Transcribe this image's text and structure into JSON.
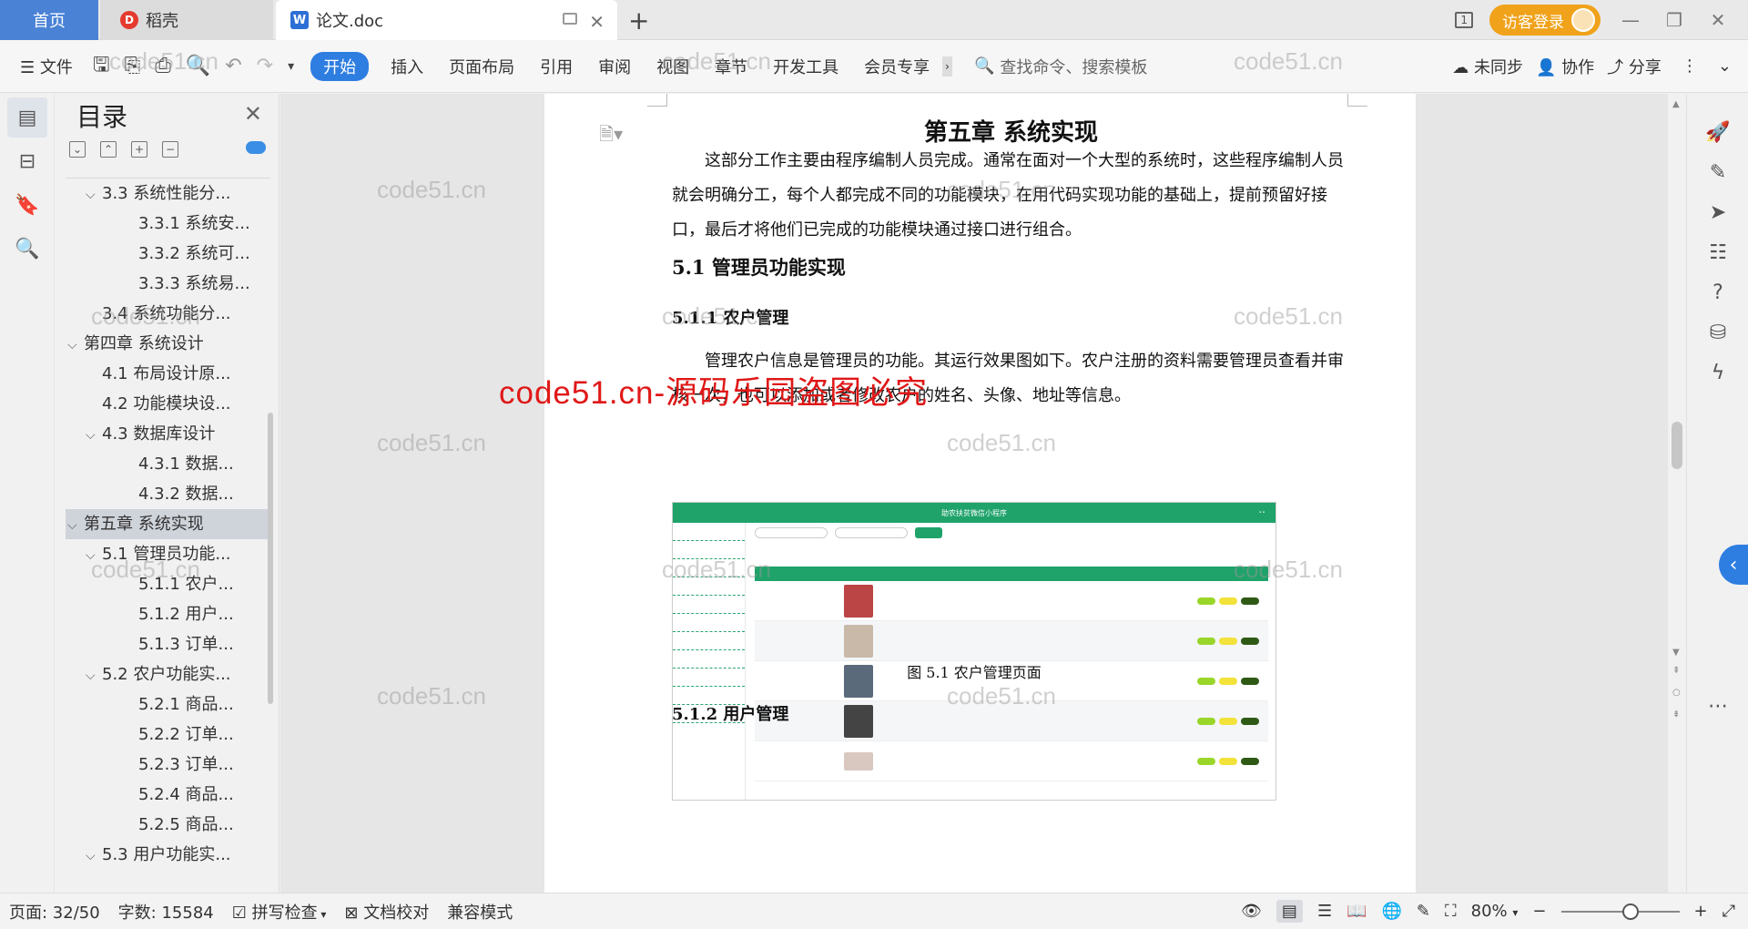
{
  "titlebar": {
    "tabs": [
      {
        "label": "首页"
      },
      {
        "label": "稻壳"
      },
      {
        "label": "论文.doc"
      }
    ],
    "new_tab": "+",
    "page_indicator": "1",
    "login_label": "访客登录"
  },
  "toolbar": {
    "file_label": "文件",
    "menus": [
      "开始",
      "插入",
      "页面布局",
      "引用",
      "审阅",
      "视图",
      "章节",
      "开发工具",
      "会员专享"
    ],
    "search_placeholder": "查找命令、搜索模板",
    "sync_label": "未同步",
    "collab_label": "协作",
    "share_label": "分享"
  },
  "toc": {
    "title": "目录",
    "items": [
      {
        "label": "3.3 系统性能分...",
        "level": 2,
        "caret": "down"
      },
      {
        "label": "3.3.1 系统安...",
        "level": 3
      },
      {
        "label": "3.3.2 系统可...",
        "level": 3
      },
      {
        "label": "3.3.3 系统易...",
        "level": 3
      },
      {
        "label": "3.4 系统功能分...",
        "level": 2
      },
      {
        "label": "第四章  系统设计",
        "level": 1,
        "caret": "down"
      },
      {
        "label": "4.1 布局设计原...",
        "level": 2
      },
      {
        "label": "4.2 功能模块设...",
        "level": 2
      },
      {
        "label": "4.3 数据库设计",
        "level": 2,
        "caret": "down"
      },
      {
        "label": "4.3.1 数据...",
        "level": 3
      },
      {
        "label": "4.3.2 数据...",
        "level": 3
      },
      {
        "label": "第五章  系统实现",
        "level": 1,
        "caret": "down",
        "selected": true
      },
      {
        "label": "5.1 管理员功能...",
        "level": 2,
        "caret": "down"
      },
      {
        "label": "5.1.1 农户...",
        "level": 3
      },
      {
        "label": "5.1.2 用户...",
        "level": 3
      },
      {
        "label": "5.1.3 订单...",
        "level": 3
      },
      {
        "label": "5.2 农户功能实...",
        "level": 2,
        "caret": "down"
      },
      {
        "label": "5.2.1 商品...",
        "level": 3
      },
      {
        "label": "5.2.2 订单...",
        "level": 3
      },
      {
        "label": "5.2.3 订单...",
        "level": 3
      },
      {
        "label": "5.2.4 商品...",
        "level": 3
      },
      {
        "label": "5.2.5 商品...",
        "level": 3
      },
      {
        "label": "5.3 用户功能实...",
        "level": 2,
        "caret": "down"
      }
    ]
  },
  "document": {
    "chapter_title": "第五章  系统实现",
    "intro": "这部分工作主要由程序编制人员完成。通常在面对一个大型的系统时，这些程序编制人员就会明确分工，每个人都完成不同的功能模块，在用代码实现功能的基础上，提前预留好接口，最后才将他们已完成的功能模块通过接口进行组合。",
    "section_5_1": "5.1  管理员功能实现",
    "section_5_1_1": "5.1.1  农户管理",
    "para_5_1_1": "管理农户信息是管理员的功能。其运行效果图如下。农户注册的资料需要管理员查看并审核一次，也可以添加或者修改农户的姓名、头像、地址等信息。",
    "figure_title": "助农扶贫微信小程序",
    "figure_caption": "图 5.1  农户管理页面",
    "section_5_1_2": "5.1.2  用户管理"
  },
  "overlay": {
    "watermark": "code51.cn",
    "banner": "code51.cn-源码乐园盗图必究"
  },
  "statusbar": {
    "page": "页面: 32/50",
    "words": "字数: 15584",
    "spell_check": "拼写检查",
    "proofread": "文档校对",
    "compat": "兼容模式",
    "zoom": "80%",
    "zoom_level": 0.6
  }
}
